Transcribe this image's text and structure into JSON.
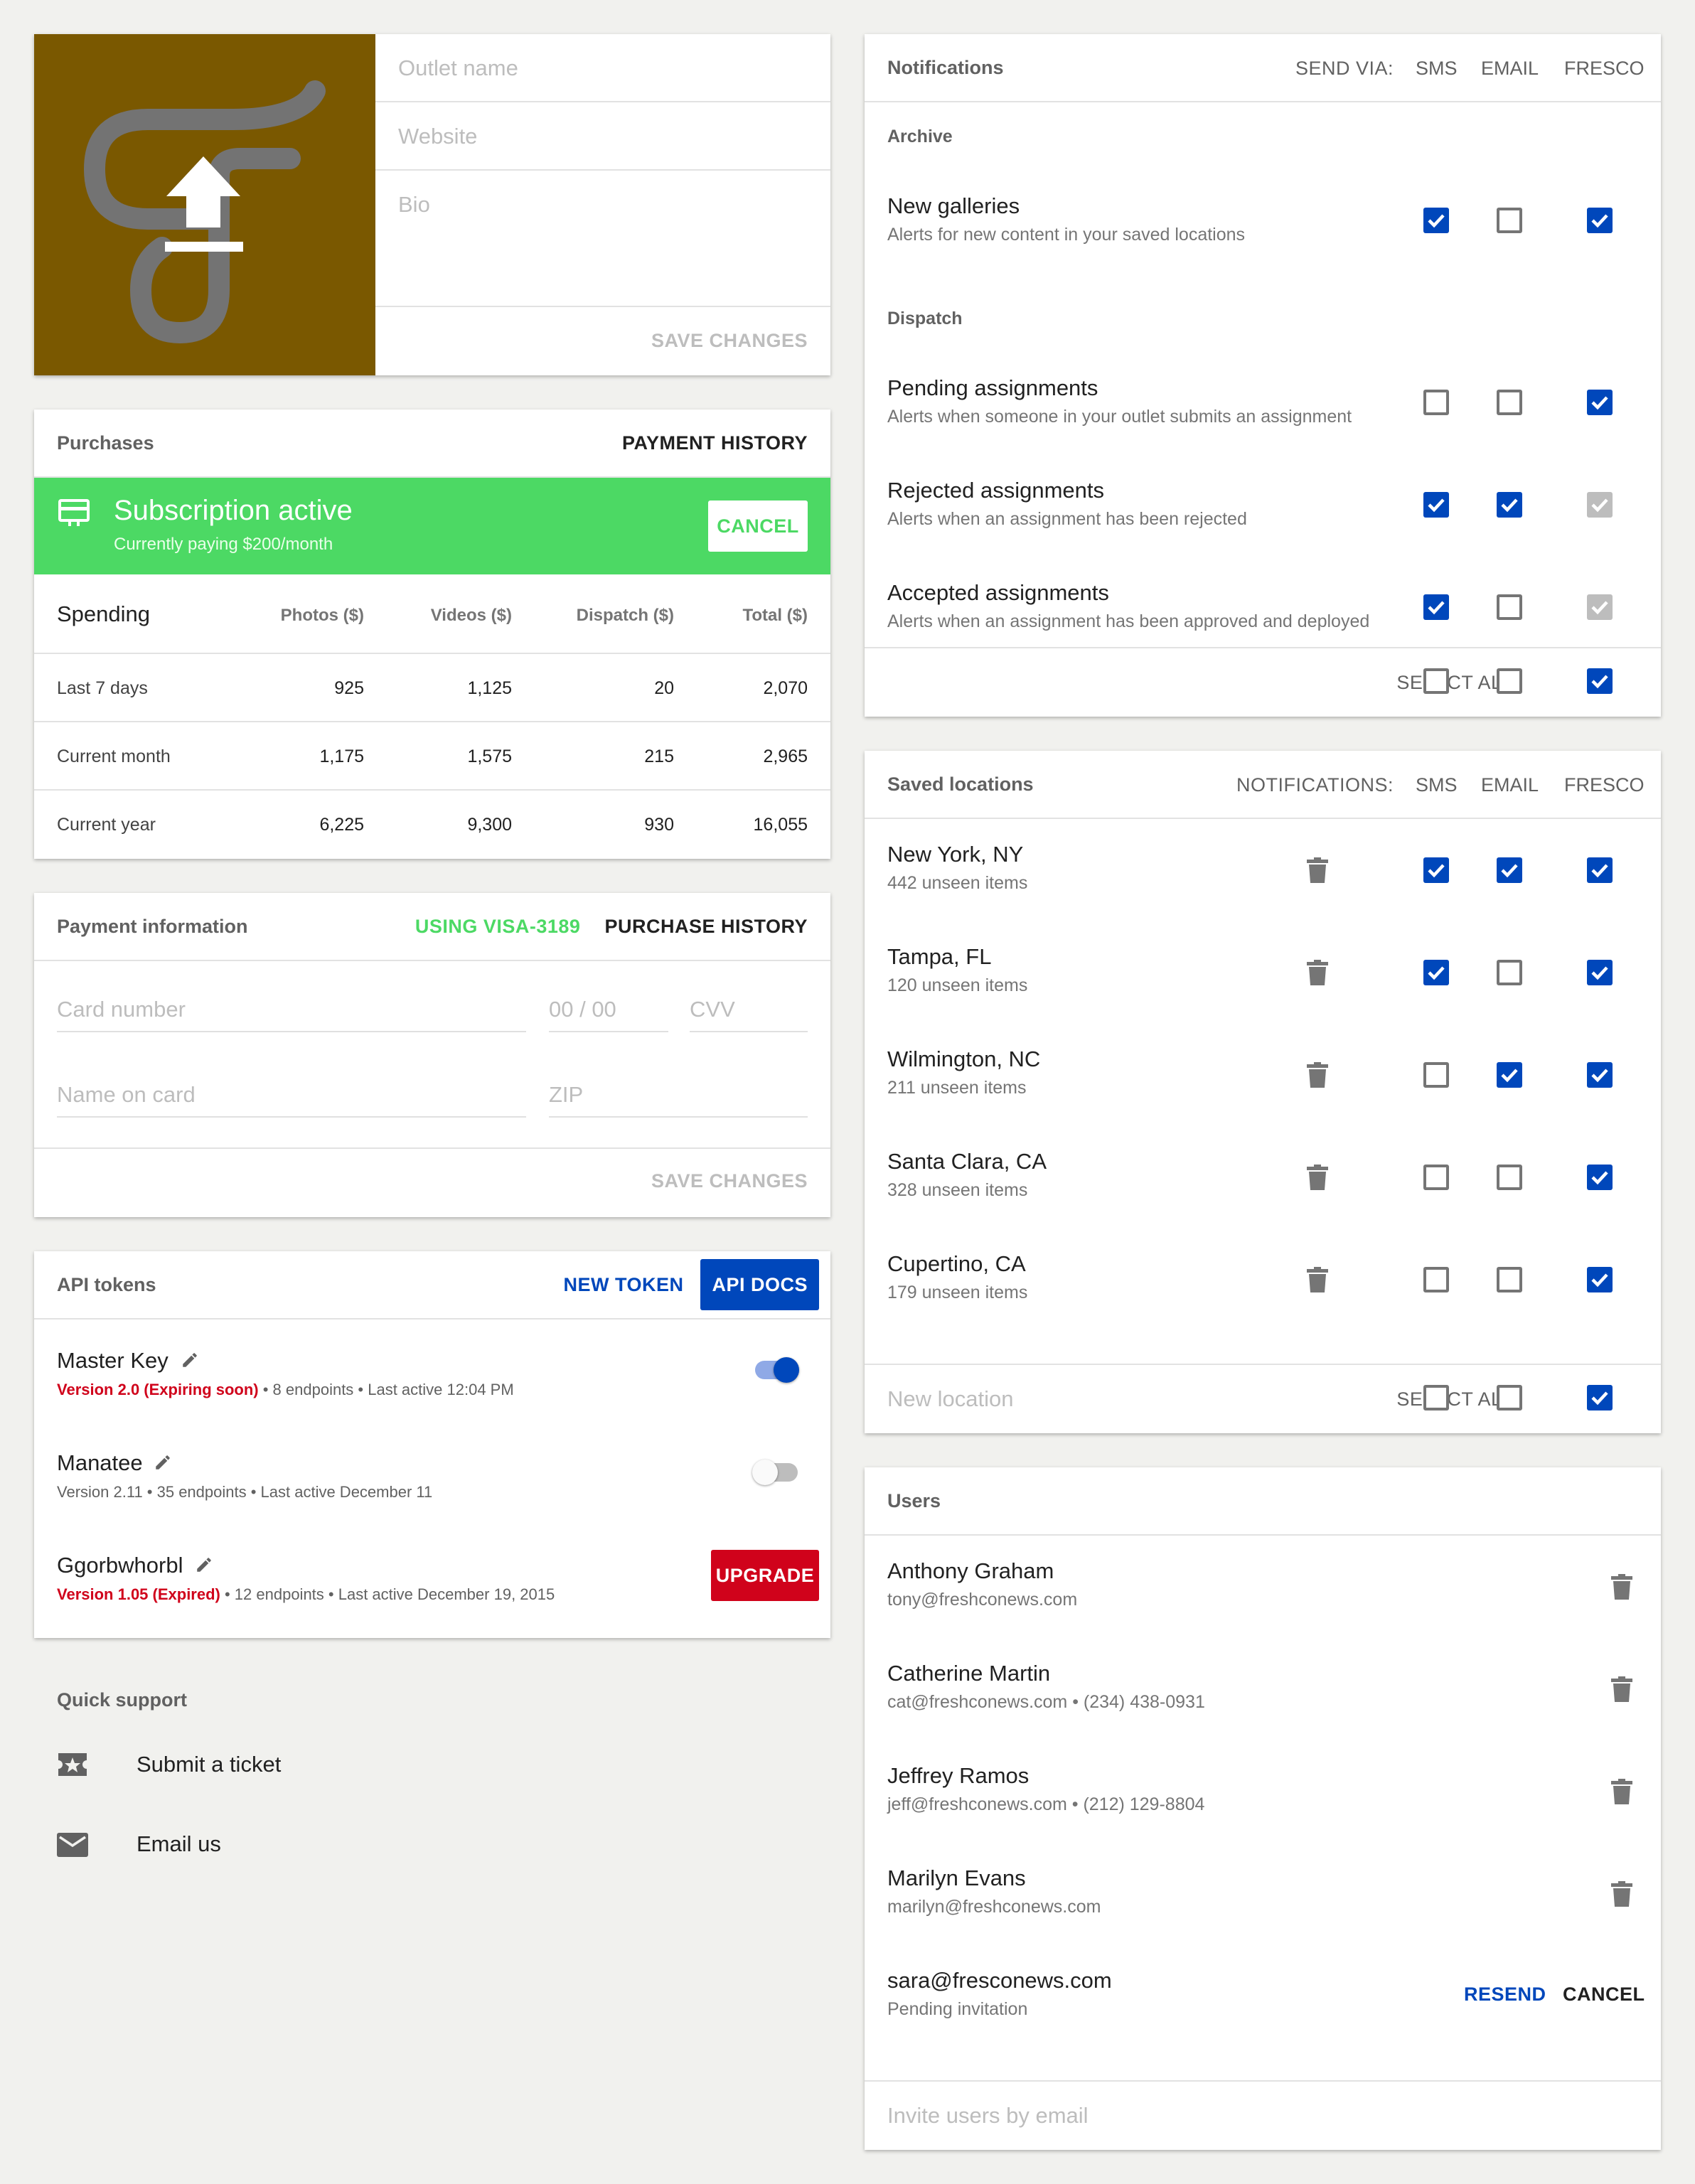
{
  "profile": {
    "outlet_name_placeholder": "Outlet name",
    "website_placeholder": "Website",
    "bio_placeholder": "Bio",
    "save_label": "SAVE CHANGES",
    "avatar_bg": "#7a5800"
  },
  "purchases": {
    "title": "Purchases",
    "history_label": "PAYMENT HISTORY",
    "banner_title": "Subscription active",
    "banner_sub": "Currently paying $200/month",
    "cancel_label": "CANCEL",
    "banner_color": "#4cd964",
    "table": {
      "title": "Spending",
      "columns": [
        "Photos ($)",
        "Videos ($)",
        "Dispatch ($)",
        "Total ($)"
      ],
      "rows": [
        {
          "label": "Last 7 days",
          "values": [
            "925",
            "1,125",
            "20",
            "2,070"
          ]
        },
        {
          "label": "Current month",
          "values": [
            "1,175",
            "1,575",
            "215",
            "2,965"
          ]
        },
        {
          "label": "Current year",
          "values": [
            "6,225",
            "9,300",
            "930",
            "16,055"
          ]
        }
      ]
    }
  },
  "payment": {
    "title": "Payment information",
    "using": "USING VISA-3189",
    "history_label": "PURCHASE HISTORY",
    "card_number_placeholder": "Card number",
    "expiry_placeholder": "00 / 00",
    "cvv_placeholder": "CVV",
    "name_placeholder": "Name on card",
    "zip_placeholder": "ZIP",
    "save_label": "SAVE CHANGES",
    "accent": "#4cd964"
  },
  "api": {
    "title": "API tokens",
    "new_token_label": "NEW TOKEN",
    "docs_label": "API DOCS",
    "tokens": [
      {
        "name": "Master Key",
        "status": "Version 2.0 (Expiring soon)",
        "meta": " • 8 endpoints • Last active 12:04 PM"
      },
      {
        "name": "Manatee",
        "status": "",
        "meta": "Version 2.11 • 35 endpoints • Last active December 11"
      },
      {
        "name": "Ggorbwhorbl",
        "status": "Version 1.05 (Expired)",
        "meta": " • 12 endpoints • Last active December 19, 2015"
      }
    ],
    "upgrade_label": "UPGRADE",
    "toggle_master_on": true,
    "toggle_manatee_on": false,
    "error_color": "#d0021b",
    "brand_blue": "#0047bb"
  },
  "support": {
    "title": "Quick support",
    "ticket_label": "Submit a ticket",
    "email_label": "Email us"
  },
  "notifications": {
    "title": "Notifications",
    "send_via": "SEND VIA:",
    "cols": [
      "SMS",
      "EMAIL",
      "FRESCO"
    ],
    "archive_label": "Archive",
    "dispatch_label": "Dispatch",
    "items": [
      {
        "title": "New galleries",
        "sub": "Alerts for new content in your saved locations",
        "checks": [
          "on",
          "off",
          "on"
        ]
      },
      {
        "title": "Pending assignments",
        "sub": "Alerts when someone in your outlet submits an assignment",
        "checks": [
          "off",
          "off",
          "on"
        ]
      },
      {
        "title": "Rejected assignments",
        "sub": "Alerts when an assignment has been rejected",
        "checks": [
          "on",
          "on",
          "dis"
        ]
      },
      {
        "title": "Accepted assignments",
        "sub": "Alerts when an assignment has been approved and deployed",
        "checks": [
          "on",
          "off",
          "dis"
        ]
      }
    ],
    "select_all": "SELECT ALL:",
    "select_all_checks": [
      "off",
      "off",
      "on"
    ]
  },
  "locations": {
    "title": "Saved locations",
    "notif_label": "NOTIFICATIONS:",
    "cols": [
      "SMS",
      "EMAIL",
      "FRESCO"
    ],
    "items": [
      {
        "title": "New York, NY",
        "sub": "442 unseen items",
        "checks": [
          "on",
          "on",
          "on"
        ]
      },
      {
        "title": "Tampa, FL",
        "sub": "120 unseen items",
        "checks": [
          "on",
          "off",
          "on"
        ]
      },
      {
        "title": "Wilmington, NC",
        "sub": "211 unseen items",
        "checks": [
          "off",
          "on",
          "on"
        ]
      },
      {
        "title": "Santa Clara, CA",
        "sub": "328 unseen items",
        "checks": [
          "off",
          "off",
          "on"
        ]
      },
      {
        "title": "Cupertino, CA",
        "sub": "179 unseen items",
        "checks": [
          "off",
          "off",
          "on"
        ]
      }
    ],
    "new_placeholder": "New location",
    "select_all": "SELECT ALL:",
    "select_all_checks": [
      "off",
      "off",
      "on"
    ]
  },
  "users": {
    "title": "Users",
    "items": [
      {
        "name": "Anthony Graham",
        "sub": "tony@freshconews.com"
      },
      {
        "name": "Catherine Martin",
        "sub": "cat@freshconews.com • (234) 438-0931"
      },
      {
        "name": "Jeffrey Ramos",
        "sub": "jeff@freshconews.com • (212) 129-8804"
      },
      {
        "name": "Marilyn Evans",
        "sub": "marilyn@freshconews.com"
      }
    ],
    "pending": {
      "name": "sara@fresconews.com",
      "sub": "Pending invitation",
      "resend": "RESEND",
      "cancel": "CANCEL"
    },
    "invite_placeholder": "Invite users by email"
  }
}
